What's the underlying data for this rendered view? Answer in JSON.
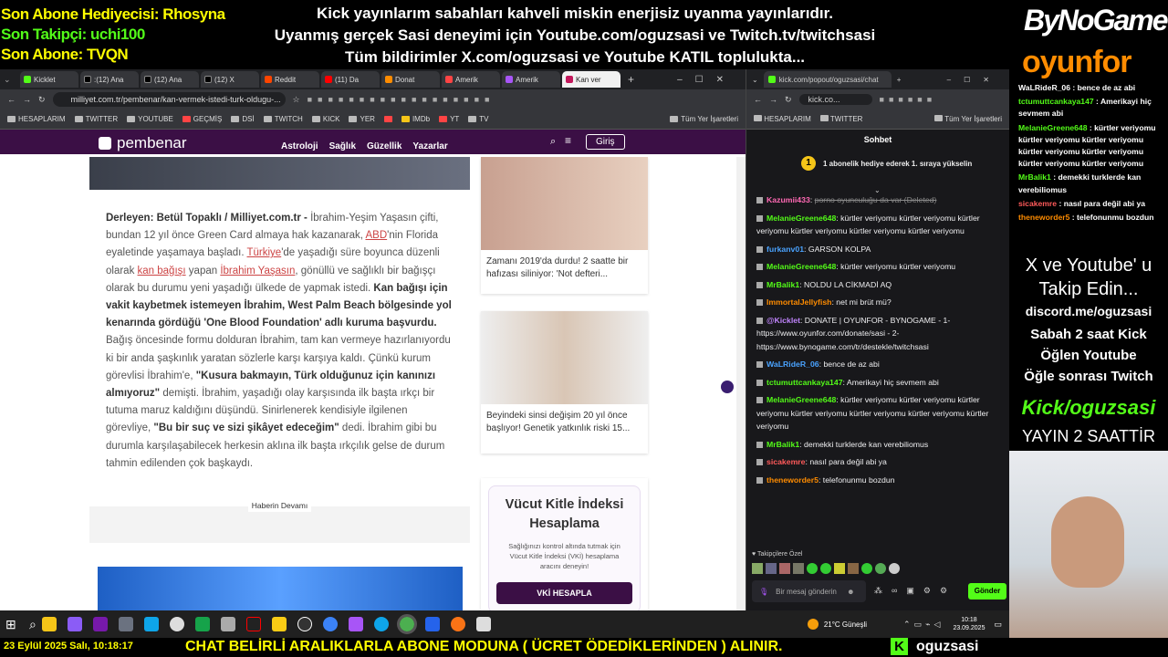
{
  "overlay": {
    "sub_gift": "Son Abone Hediyecisi: Rhosyna",
    "last_follower": "Son Takipçi: uchi100",
    "last_sub": "Son Abone: TVQN",
    "top_line1": "Kick yayınlarım sabahları kahveli miskin enerjisiz uyanma yayınlarıdır.",
    "top_line2": "Uyanmış gerçek Sasi deneyimi için Youtube.com/oguzsasi ve Twitch.tv/twitchsasi",
    "top_line3": "Tüm bildirimler X.com/oguzsasi ve Youtube KATIL topluluktа...",
    "logo1": "ByNoGame",
    "logo2": "oyunfor",
    "follow1": "X ve Youtube' u",
    "follow2": "Takip Edin...",
    "discord": "discord.me/oguzsasi",
    "sched1": "Sabah 2 saat Kick",
    "sched2": "Öğlen Youtube",
    "sched3": "Öğle sonrası Twitch",
    "kick_handle": "Kick/oguzsasi",
    "duration": "YAYIN 2 SAATTİR",
    "datetime": "23 Eylül 2025 Salı, 10:18:17",
    "bottom_msg": "CHAT BELİRLİ ARALIKLARLA ABONE MODUNA ( ÜCRET ÖDEDİKLERİNDEN ) ALINIR.",
    "channel": "oguzsasi",
    "colors": {
      "green": "#53fc18",
      "yellow": "#ffff00",
      "orange": "#ff8c00"
    }
  },
  "left_browser": {
    "tabs": [
      "Kicklet",
      ":(12) Ana",
      "(12) Ana",
      "(12) X",
      "Reddit",
      "(11) Da",
      "Donat",
      "Amerik",
      "Amerik",
      "Kan ver"
    ],
    "url": "milliyet.com.tr/pembenar/kan-vermek-istedi-turk-oldugu-...",
    "bookmarks": [
      "HESAPLARIM",
      "TWITTER",
      "YOUTUBE",
      "GEÇMİŞ",
      "DSİ",
      "TWITCH",
      "KICK",
      "YER",
      "",
      "IMDb",
      "YT",
      "TV",
      "Tüm Yer İşaretleri"
    ],
    "site_logo": "pembenar",
    "menu": [
      "Astroloji",
      "Sağlık",
      "Güzellik",
      "Yazarlar"
    ],
    "login": "Giriş",
    "article_runs": [
      {
        "t": "Derleyen: Betül Topaklı / Milliyet.com.tr - ",
        "s": "b"
      },
      {
        "t": "İbrahim-Yeşim Yaşasın çifti, bundan 12 yıl önce Green Card almaya hak kazanarak, ",
        "s": "n"
      },
      {
        "t": "ABD",
        "s": "u"
      },
      {
        "t": "'nin Florida eyaletinde yaşamaya başladı. ",
        "s": "n"
      },
      {
        "t": "Türkiye",
        "s": "u"
      },
      {
        "t": "'de yaşadığı süre boyunca düzenli olarak ",
        "s": "n"
      },
      {
        "t": "kan bağışı",
        "s": "u"
      },
      {
        "t": " yapan ",
        "s": "n"
      },
      {
        "t": "İbrahim Yaşasın",
        "s": "u"
      },
      {
        "t": ", gönüllü ve sağlıklı bir bağışçı olarak bu durumu yeni yaşadığı ülkede de yapmak istedi. ",
        "s": "n"
      },
      {
        "t": "Kan bağışı için vakit kaybetmek istemeyen İbrahim, West Palm Beach bölgesinde yol kenarında gördüğü 'One Blood Foundation' adlı kuruma başvurdu.",
        "s": "b"
      },
      {
        "t": " Bağış öncesinde formu dolduran İbrahim, tam kan vermeye hazırlanıyordu ki bir anda şaşkınlık yaratan sözlerle karşı karşıya kaldı. Çünkü kurum görevlisi İbrahim'e, ",
        "s": "n"
      },
      {
        "t": "\"Kusura bakmayın, Türk olduğunuz için kanınızı almıyoruz\"",
        "s": "b"
      },
      {
        "t": " demişti. İbrahim, yaşadığı olay karşısında ilk başta ırkçı bir tutuma maruz kaldığını düşündü. Sinirlenerek kendisiyle ilgilenen görevliye, ",
        "s": "n"
      },
      {
        "t": "\"Bu bir suç ve sizi şikâyet edeceğim\"",
        "s": "b"
      },
      {
        "t": " dedi. İbrahim gibi bu durumla karşılaşabilecek herkesin aklına ilk başta ırkçılık gelse de durum tahmin edilenden çok başkaydı.",
        "s": "n"
      }
    ],
    "more": "Haberin Devamı",
    "card1": "Zamanı 2019'da durdu! 2 saatte bir hafızası siliniyor: 'Not defteri...",
    "card2": "Beyindeki sinsi değişim 20 yıl önce başlıyor! Genetik yatkınlık riski 15...",
    "bmi_title": "Vücut Kitle İndeksi Hesaplama",
    "bmi_desc": "Sağlığınızı kontrol altında tutmak için Vücut Kitle İndeksi (VKİ) hesaplama aracını deneyin!",
    "bmi_btn": "VKİ HESAPLA"
  },
  "right_browser": {
    "url": "kick.com/popout/oguzsasi/chat",
    "url_short": "kick.co...",
    "bookmarks": [
      "HESAPLARIM",
      "TWITTER",
      "Tüm Yer İşaretleri"
    ],
    "title": "Sohbet",
    "gift_banner": "1 abonelik hediye ederek 1. sıraya yükselin",
    "gift_num": "1",
    "messages": [
      {
        "user": "Kazumii433",
        "color": "#ff69b4",
        "text": "porno oyunculuğu da var (Deleted)",
        "deleted": true
      },
      {
        "user": "MelanieGreene648",
        "color": "#53fc18",
        "text": "kürtler veriyomu kürtler veriyomu kürtler veriyomu kürtler veriyomu kürtler veriyomu kürtler veriyomu"
      },
      {
        "user": "furkanv01",
        "color": "#4aa3ff",
        "text": "GARSON KOLPA"
      },
      {
        "user": "MelanieGreene648",
        "color": "#53fc18",
        "text": "kürtler veriyomu kürtler veriyomu"
      },
      {
        "user": "MrBalik1",
        "color": "#53fc18",
        "text": "NOLDU LA CİKMADİ AQ"
      },
      {
        "user": "ImmortalJellyfish",
        "color": "#ff8c00",
        "text": "net mi brüt mü?"
      },
      {
        "user": "@Kicklet",
        "color": "#c084fc",
        "text": "DONATE | OYUNFOR - BYNOGAME - 1- https://www.oyunfor.com/donate/sasi - 2- https://www.bynogame.com/tr/destekle/twitchsasi"
      },
      {
        "user": "WaLRideR_06",
        "color": "#4aa3ff",
        "text": "bence de az abi"
      },
      {
        "user": "tctumuttcankaya147",
        "color": "#53fc18",
        "text": "Amerikayi hiç sevmem abi"
      },
      {
        "user": "MelanieGreene648",
        "color": "#53fc18",
        "text": "kürtler veriyomu kürtler veriyomu kürtler veriyomu kürtler veriyomu kürtler veriyomu kürtler veriyomu kürtler veriyomu"
      },
      {
        "user": "MrBalik1",
        "color": "#53fc18",
        "text": "demekki turklerde kan verebiliomus"
      },
      {
        "user": "sicakemre",
        "color": "#ff5a5a",
        "text": "nasıl para değil abi ya"
      },
      {
        "user": "theneworder5",
        "color": "#ff8c00",
        "text": "telefonunmu bozdun"
      }
    ],
    "followers_label": "Takipçilere Özel",
    "input_placeholder": "Bir mesaj gönderin",
    "send": "Gönder"
  },
  "overlay_chat": [
    {
      "user": "WaLRideR_06",
      "text": "bence de az abi",
      "color": "#fff"
    },
    {
      "user": "tctumuttcankaya147",
      "text": "Amerikayi hiç sevmem abi",
      "color": "#53fc18"
    },
    {
      "user": "MelanieGreene648",
      "text": "kürtler veriyomu kürtler veriyomu kürtler veriyomu kürtler veriyomu kürtler veriyomu kürtler veriyomu kürtler veriyomu",
      "color": "#53fc18"
    },
    {
      "user": "MrBalik1",
      "text": "demekki turklerde kan verebiliomus",
      "color": "#53fc18"
    },
    {
      "user": "sicakemre",
      "text": "nasıl para değil abi ya",
      "color": "#ff5a5a"
    },
    {
      "user": "theneworder5",
      "text": "telefonunmu bozdun",
      "color": "#ff8c00"
    }
  ],
  "taskbar": {
    "weather": "21°C  Güneşli",
    "time": "10:18",
    "date": "23.09.2025"
  }
}
